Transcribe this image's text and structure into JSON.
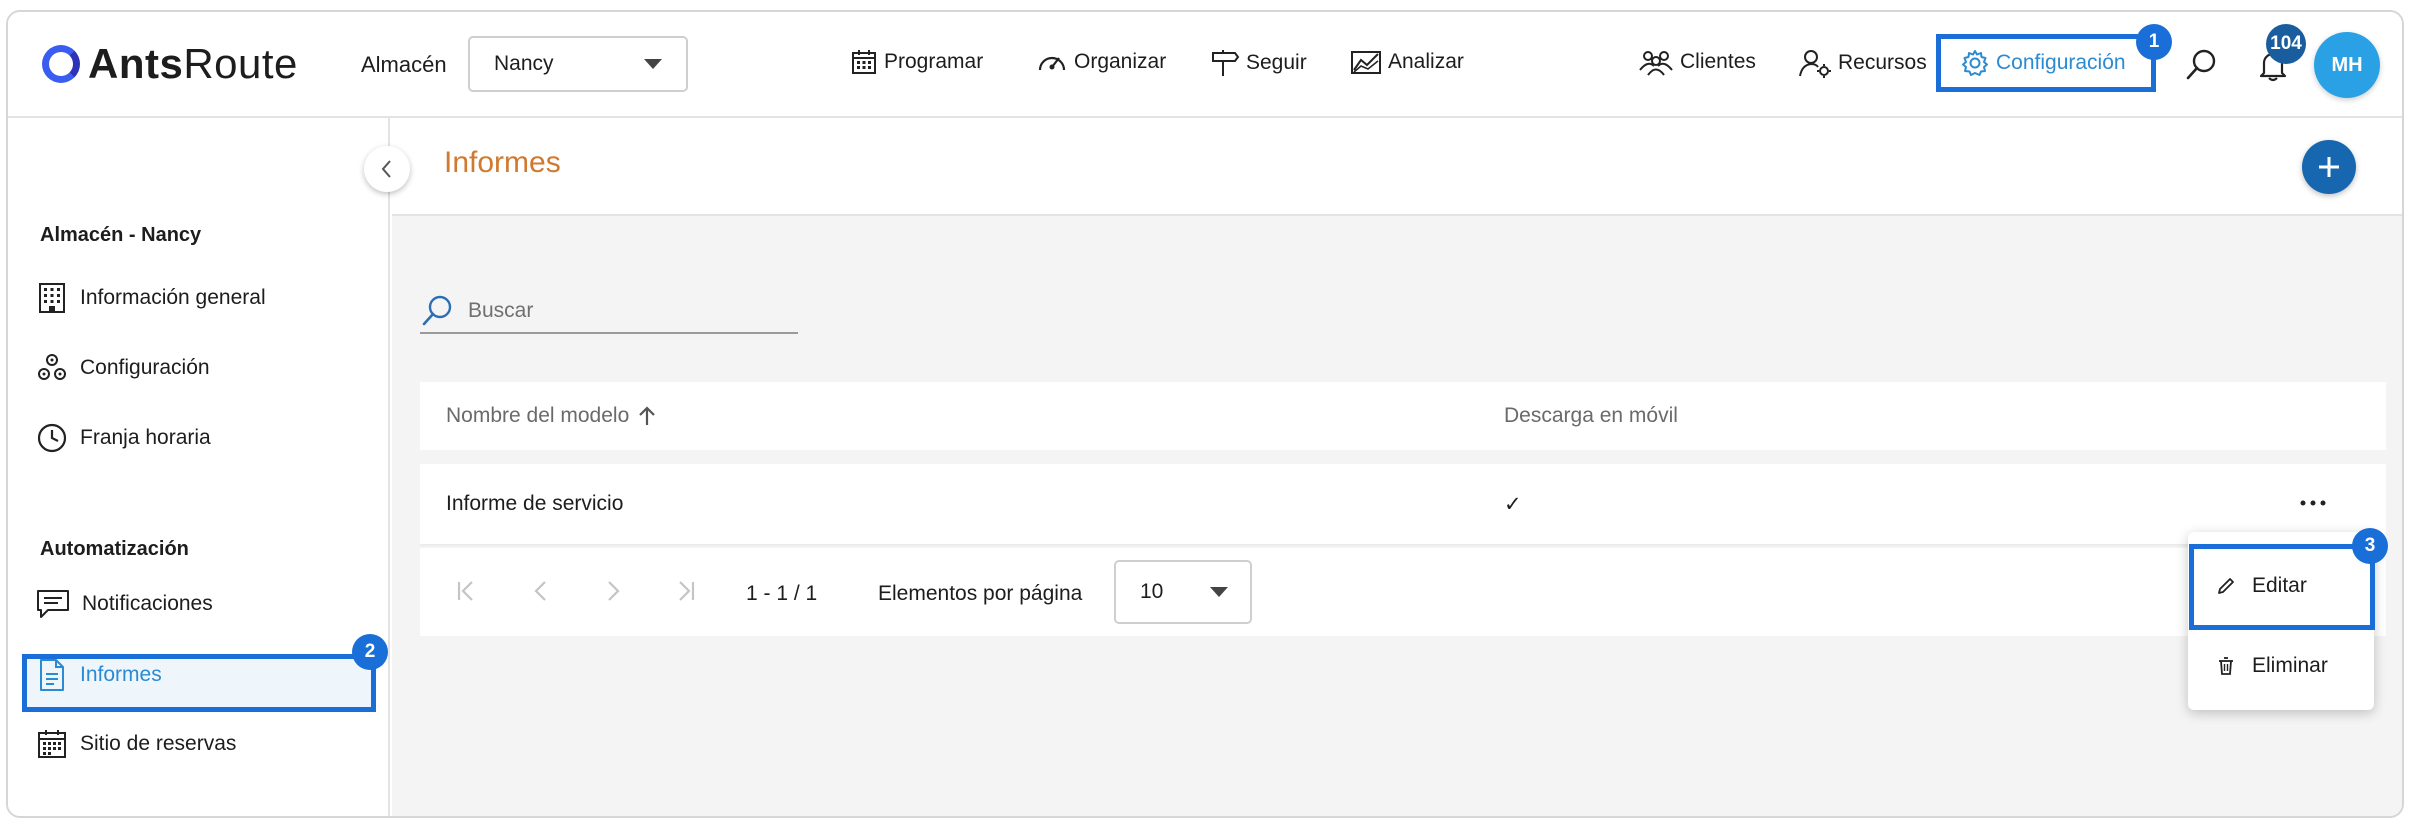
{
  "header": {
    "logo_bold": "Ants",
    "logo_regular": "Route",
    "warehouse_label": "Almacén",
    "warehouse_value": "Nancy",
    "nav": [
      {
        "label": "Programar",
        "icon": "calendar-icon"
      },
      {
        "label": "Organizar",
        "icon": "speedometer-icon"
      },
      {
        "label": "Seguir",
        "icon": "signpost-icon"
      },
      {
        "label": "Analizar",
        "icon": "chart-icon"
      }
    ],
    "right_nav": [
      {
        "label": "Clientes",
        "icon": "clients-icon"
      },
      {
        "label": "Recursos",
        "icon": "resources-icon"
      },
      {
        "label": "Configuración",
        "icon": "gear-icon",
        "active": true
      }
    ],
    "notification_count": "104",
    "avatar_initials": "MH"
  },
  "callouts": [
    "1",
    "2",
    "3"
  ],
  "sidebar": {
    "section1_title": "Almacén - Nancy",
    "section1_items": [
      {
        "label": "Información general",
        "icon": "building-icon"
      },
      {
        "label": "Configuración",
        "icon": "cogs-icon"
      },
      {
        "label": "Franja horaria",
        "icon": "clock-icon"
      }
    ],
    "section2_title": "Automatización",
    "section2_items": [
      {
        "label": "Notificaciones",
        "icon": "message-icon"
      },
      {
        "label": "Informes",
        "icon": "document-icon",
        "active": true
      },
      {
        "label": "Sitio de reservas",
        "icon": "calendar-grid-icon"
      }
    ]
  },
  "main": {
    "title": "Informes",
    "search_placeholder": "Buscar",
    "columns": [
      "Nombre del modelo",
      "Descarga en móvil"
    ],
    "rows": [
      {
        "name": "Informe de servicio",
        "mobile_download": "✓"
      }
    ],
    "pagination": {
      "range": "1 - 1 / 1",
      "per_page_label": "Elementos por página",
      "per_page_value": "10"
    }
  },
  "context_menu": {
    "items": [
      {
        "label": "Editar",
        "icon": "pencil-icon"
      },
      {
        "label": "Eliminar",
        "icon": "trash-icon"
      }
    ]
  },
  "colors": {
    "accent": "#2a8bd3",
    "callout": "#1a6ed8",
    "title": "#d0792f",
    "add_button": "#1767b0"
  }
}
